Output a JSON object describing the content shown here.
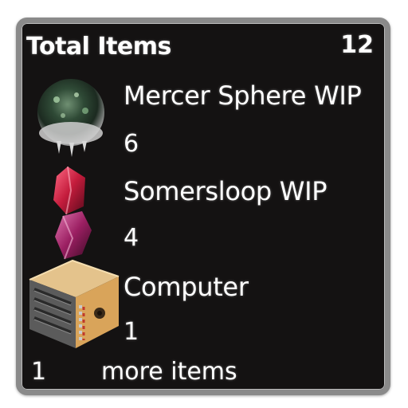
{
  "header": {
    "title": "Total Items",
    "total": "12"
  },
  "items": [
    {
      "name": "Mercer Sphere WIP",
      "count": "6",
      "icon": "mercer-sphere-icon"
    },
    {
      "name": "Somersloop WIP",
      "count": "4",
      "icon": "somersloop-icon"
    },
    {
      "name": "Computer",
      "count": "1",
      "icon": "computer-icon"
    }
  ],
  "footer": {
    "count": "1",
    "label": "more items"
  },
  "colors": {
    "panel_background": "#141212",
    "frame_border": "#8a8a8a",
    "text": "#ffffff"
  }
}
